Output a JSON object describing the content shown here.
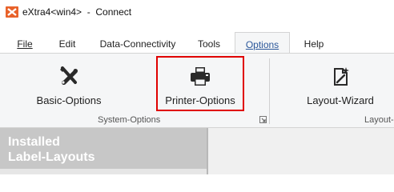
{
  "window": {
    "title": "eXtra4<win4>  -  Connect"
  },
  "tabs": [
    {
      "label": "File"
    },
    {
      "label": "Edit"
    },
    {
      "label": "Data-Connectivity"
    },
    {
      "label": "Tools"
    },
    {
      "label": "Options",
      "selected": true
    },
    {
      "label": "Help"
    }
  ],
  "ribbon": {
    "basic_options": {
      "label": "Basic-Options",
      "icon": "wrench-screwdriver-icon"
    },
    "printer_options": {
      "label": "Printer-Options",
      "icon": "printer-icon",
      "highlighted": true,
      "highlight_color": "#e00000"
    },
    "layout_wizard": {
      "label": "Layout-Wizard",
      "icon": "wizard-document-icon"
    },
    "group_system": "System-Options",
    "group_layout": "Layout-"
  },
  "panel": {
    "title_line1": "Installed",
    "title_line2": "Label-Layouts"
  },
  "colors": {
    "accent": "#2b579a",
    "highlight": "#e00000",
    "panel_bg": "#c7c7c7"
  }
}
